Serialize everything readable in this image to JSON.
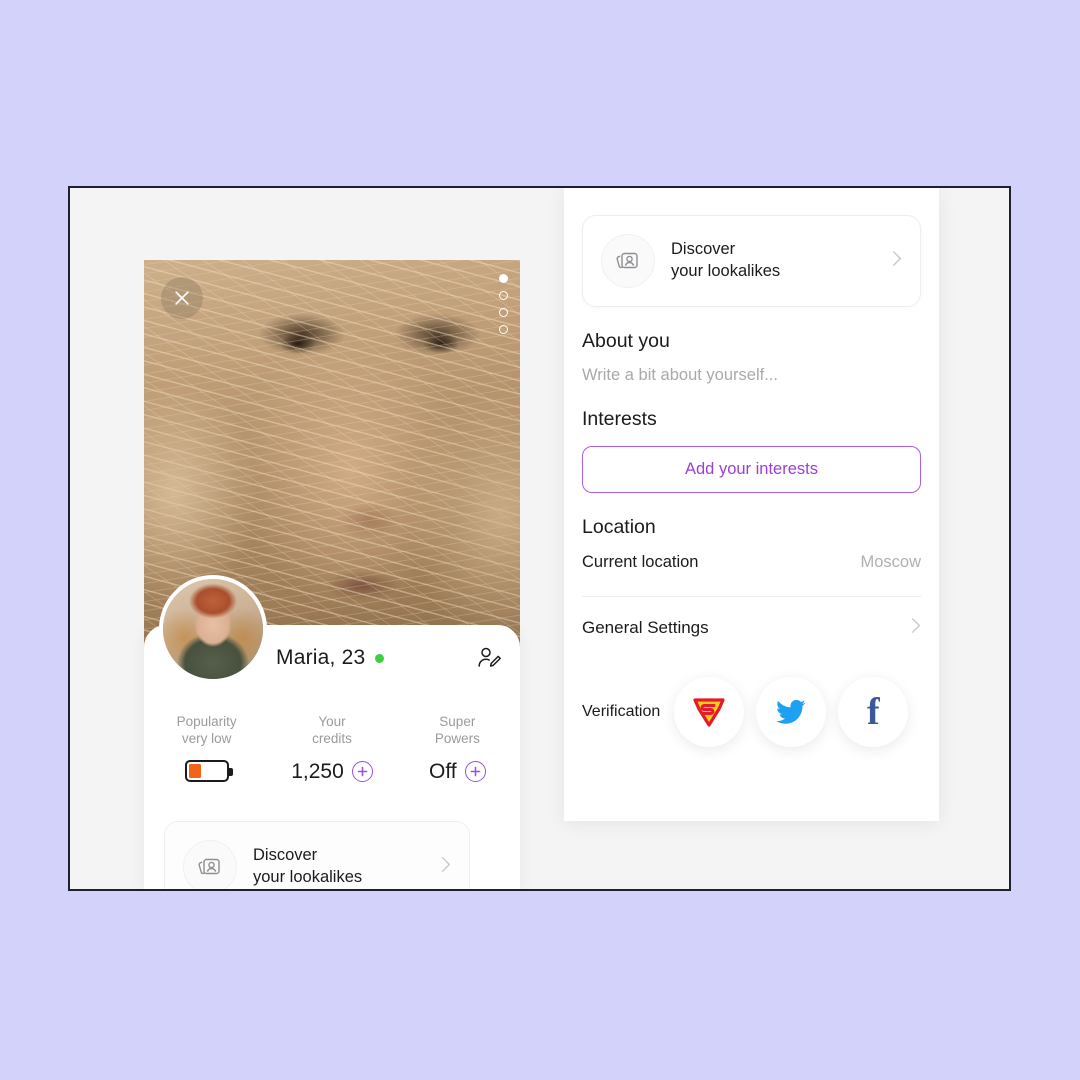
{
  "colors": {
    "page_background": "#d2d2fb",
    "frame_border": "#1d2033",
    "accent_purple": "#9b51e0",
    "battery_orange": "#f4631a",
    "online_green": "#3ecf3e",
    "twitter_blue": "#1da1f2",
    "facebook_blue": "#3b5998",
    "badge_red": "#e8192c",
    "badge_yellow": "#fbd115"
  },
  "photo_card": {
    "close_icon": "close-icon",
    "camera_icon": "camera-add-icon",
    "pagination": {
      "total": 4,
      "active_index": 0
    }
  },
  "profile": {
    "name": "Maria, 23",
    "online": true,
    "avatar_name": "profile-avatar",
    "edit_icon": "edit-profile-icon",
    "stats": [
      {
        "label_line1": "Popularity",
        "label_line2": "very low",
        "value": "",
        "widget": "battery",
        "battery_percent": 35
      },
      {
        "label_line1": "Your",
        "label_line2": "credits",
        "value": "1,250",
        "widget": "plus"
      },
      {
        "label_line1": "Super",
        "label_line2": "Powers",
        "value": "Off",
        "widget": "plus"
      }
    ]
  },
  "lookalikes_card": {
    "icon": "photo-stack-person-icon",
    "line1": "Discover",
    "line2": "your lookalikes",
    "chevron": "chevron-right-icon"
  },
  "settings": {
    "about": {
      "title": "About you",
      "placeholder": "Write a bit about yourself..."
    },
    "interests": {
      "title": "Interests",
      "button_label": "Add your interests"
    },
    "location": {
      "title": "Location",
      "row_label": "Current location",
      "row_value": "Moscow"
    },
    "general": {
      "label": "General Settings",
      "chevron": "chevron-right-icon"
    },
    "verification": {
      "label": "Verification",
      "badges": [
        {
          "name": "superpower-shield-icon",
          "letter": "S"
        },
        {
          "name": "twitter-icon"
        },
        {
          "name": "facebook-icon",
          "letter": "f"
        }
      ]
    }
  }
}
